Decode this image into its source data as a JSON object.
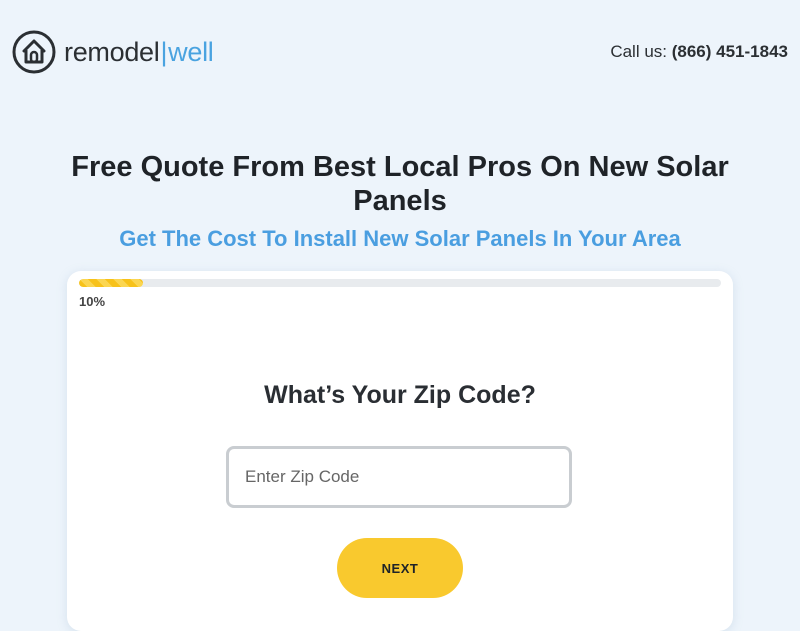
{
  "header": {
    "logo": {
      "word1": "remodel",
      "separator": "|",
      "word2": "well",
      "icon": "house-icon"
    },
    "phone": {
      "prefix": "Call us:",
      "number": "(866) 451-1843"
    }
  },
  "hero": {
    "title": "Free Quote From Best Local Pros On New Solar Panels",
    "subtitle": "Get The Cost To Install New Solar Panels In Your Area"
  },
  "form": {
    "progress": {
      "percent": 10,
      "label": "10%"
    },
    "question": "What’s Your Zip Code?",
    "zip": {
      "placeholder": "Enter Zip Code",
      "value": ""
    },
    "next_label": "NEXT"
  },
  "colors": {
    "accent_blue": "#4a9ee0",
    "button_yellow": "#f9c92e",
    "page_background": "#edf4fb"
  }
}
